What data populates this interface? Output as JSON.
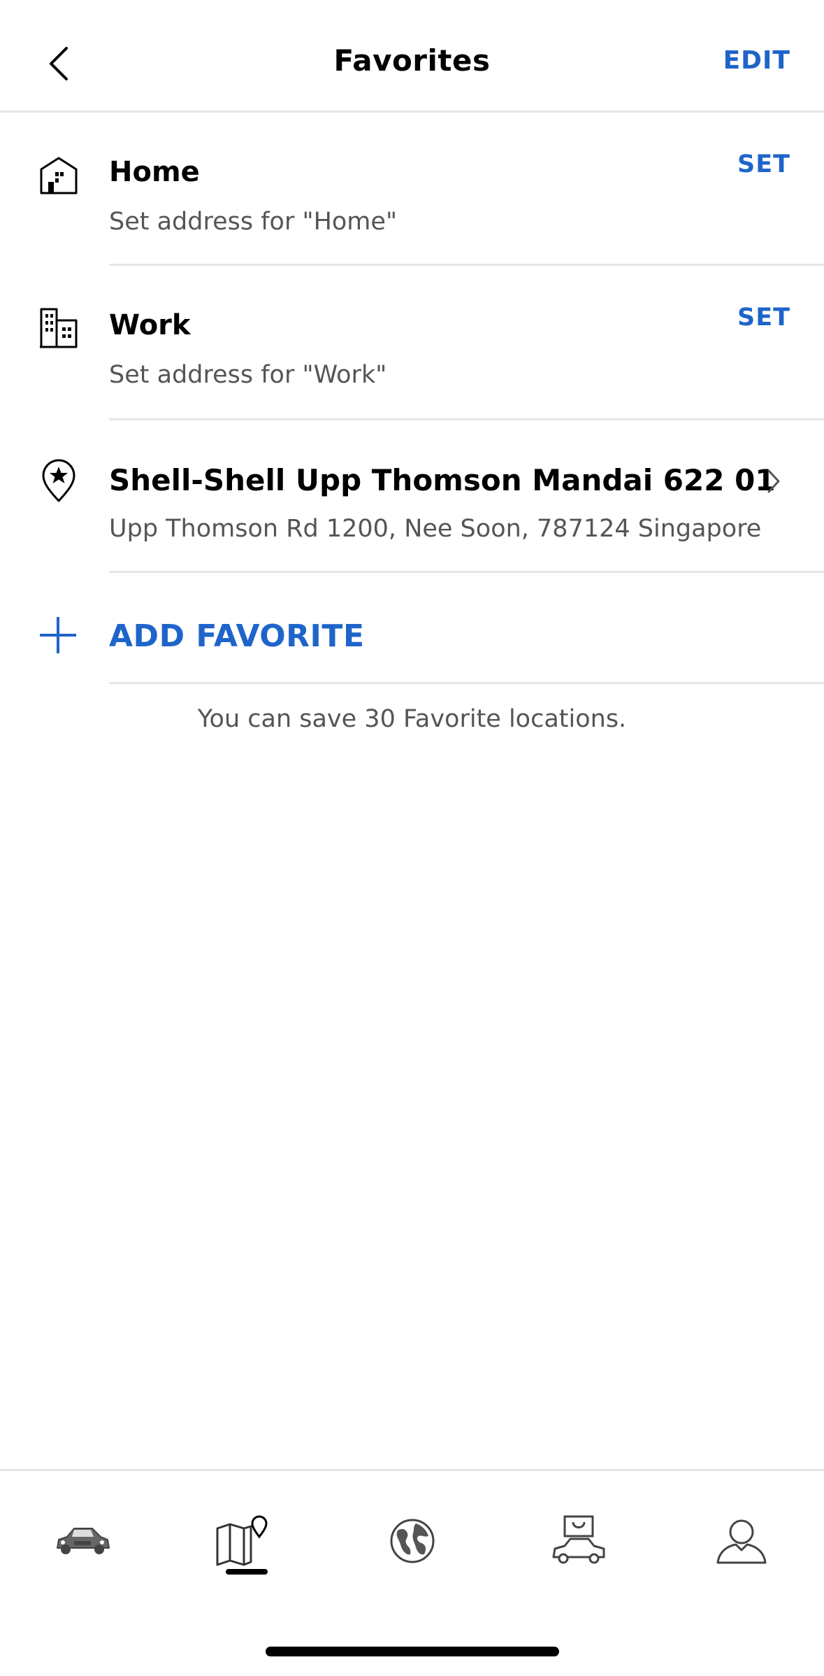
{
  "header": {
    "title": "Favorites",
    "edit_label": "EDIT"
  },
  "favorites": [
    {
      "name": "Home",
      "subtitle": "Set address for \"Home\"",
      "action": "SET",
      "icon": "house-icon"
    },
    {
      "name": "Work",
      "subtitle": "Set address for \"Work\"",
      "action": "SET",
      "icon": "building-icon"
    },
    {
      "name": "Shell-Shell Upp Thomson Mandai 622 01",
      "subtitle": "Upp Thomson Rd 1200, Nee Soon, 787124 Singapore",
      "icon": "star-pin-icon"
    }
  ],
  "add_favorite": {
    "label": "ADD FAVORITE",
    "icon": "plus-icon"
  },
  "note": "You can save 30 Favorite locations.",
  "tabs": [
    {
      "name": "vehicle",
      "icon": "car-icon"
    },
    {
      "name": "map",
      "icon": "map-pin-icon",
      "selected": true
    },
    {
      "name": "explore",
      "icon": "globe-icon"
    },
    {
      "name": "shop",
      "icon": "car-shop-icon"
    },
    {
      "name": "profile",
      "icon": "person-icon"
    }
  ],
  "colors": {
    "accent": "#1f65c9",
    "divider": "#e6e6e6",
    "secondary_text": "#555555"
  }
}
